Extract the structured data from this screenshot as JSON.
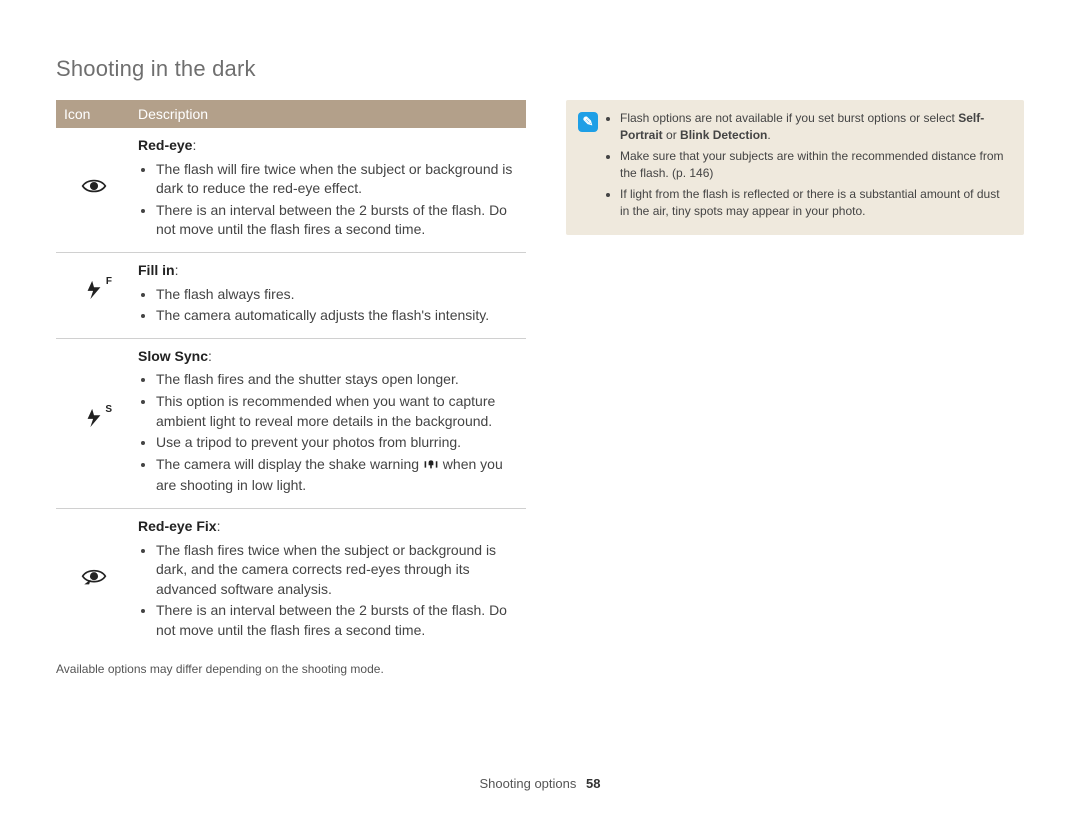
{
  "section_title": "Shooting in the dark",
  "table": {
    "headers": {
      "icon": "Icon",
      "desc": "Description"
    },
    "rows": [
      {
        "icon_name": "red-eye-icon",
        "title": "Red-eye",
        "colon": ":",
        "bullets": [
          "The flash will fire twice when the subject or background is dark to reduce the red-eye effect.",
          "There is an interval between the 2 bursts of the flash. Do not move until the flash fires a second time."
        ]
      },
      {
        "icon_name": "fill-in-icon",
        "title": "Fill in",
        "colon": ":",
        "bullets": [
          "The flash always fires.",
          "The camera automatically adjusts the flash's intensity."
        ]
      },
      {
        "icon_name": "slow-sync-icon",
        "title": "Slow Sync",
        "colon": ":",
        "bullets": [
          "The flash fires and the shutter stays open longer.",
          "This option is recommended when you want to capture ambient light to reveal more details in the background.",
          "Use a tripod to prevent your photos from blurring.",
          "The camera will display the shake warning {SHAKE_ICON} when you are shooting in low light."
        ]
      },
      {
        "icon_name": "red-eye-fix-icon",
        "title": "Red-eye Fix",
        "colon": ":",
        "bullets": [
          "The flash fires twice when the subject or background is dark, and the camera corrects red-eyes through its advanced software analysis.",
          "There is an interval between the 2 bursts of the flash. Do not move until the flash fires a second time."
        ]
      }
    ]
  },
  "footnote": "Available options may differ depending on the shooting mode.",
  "note": {
    "items": [
      {
        "prefix": "Flash options are not available if you set burst options or select ",
        "bold": "Self-Portrait",
        "mid": " or ",
        "bold2": "Blink Detection",
        "suffix": "."
      },
      {
        "text": "Make sure that your subjects are within the recommended distance from the flash. (p. 146)"
      },
      {
        "text": "If light from the flash is reflected or there is a substantial amount of dust in the air, tiny spots may appear in your photo."
      }
    ]
  },
  "footer": {
    "section": "Shooting options",
    "page": "58"
  },
  "icons": {
    "note_glyph": "✎",
    "flash_f_sup": "F",
    "flash_s_sup": "S"
  }
}
